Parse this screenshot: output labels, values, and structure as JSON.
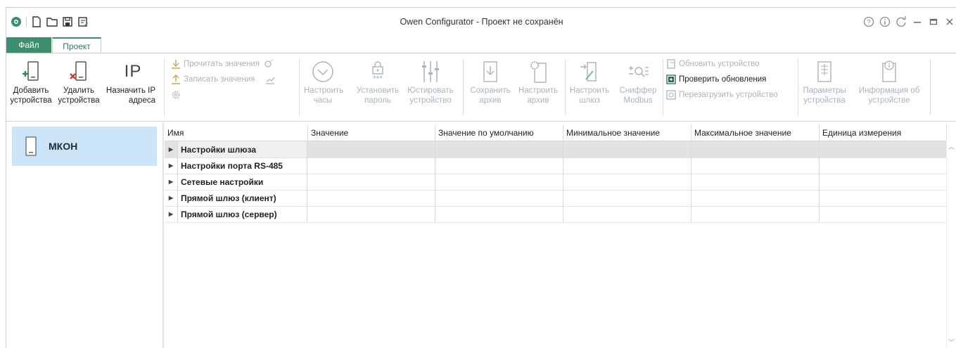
{
  "window": {
    "title": "Owen Configurator - Проект не сохранён",
    "controls": [
      "help-icon",
      "info-icon",
      "update-icon",
      "minimize-icon",
      "maximize-icon",
      "close-icon"
    ]
  },
  "quick_access": [
    "owen-logo-icon",
    "new-file-icon",
    "open-folder-icon",
    "save-icon",
    "save-as-icon"
  ],
  "tabs": [
    {
      "label": "Файл",
      "active": false
    },
    {
      "label": "Проект",
      "active": true
    }
  ],
  "ribbon": {
    "add_device": "Добавить\nустройства",
    "remove_device": "Удалить\nустройства",
    "assign_ip": "Назначить IP\nадреса",
    "ip_icon_text": "IP",
    "read_values": "Прочитать значения",
    "write_values": "Записать значения",
    "set_clock": "Настроить\nчасы",
    "set_password": "Установить\nпароль",
    "password_mask": "***",
    "calibrate": "Юстировать\nустройство",
    "save_archive": "Сохранить\nархив",
    "config_archive": "Настроить\nархив",
    "config_gateway": "Настроить\nшлюз",
    "sniffer": "Сниффер\nModbus",
    "update_device": "Обновить устройство",
    "check_updates": "Проверить обновления",
    "reboot_device": "Перезагрузить устройство",
    "device_params": "Параметры\nустройства",
    "device_info": "Информация об\nустройстве"
  },
  "devices": [
    {
      "name": "МКОН",
      "selected": true
    }
  ],
  "table": {
    "columns": [
      "Имя",
      "Значение",
      "Значение по умолчанию",
      "Минимальное значение",
      "Максимальное значение",
      "Единица измерения"
    ],
    "rows": [
      {
        "name": "Настройки шлюза",
        "selected": true
      },
      {
        "name": "Настройки порта RS-485",
        "selected": false
      },
      {
        "name": "Сетевые настройки",
        "selected": false
      },
      {
        "name": "Прямой шлюз (клиент)",
        "selected": false
      },
      {
        "name": "Прямой шлюз (сервер)",
        "selected": false
      }
    ]
  },
  "colors": {
    "accent": "#3d8f6c",
    "selection": "#cce4f7",
    "disabled": "#a9b4bc"
  }
}
